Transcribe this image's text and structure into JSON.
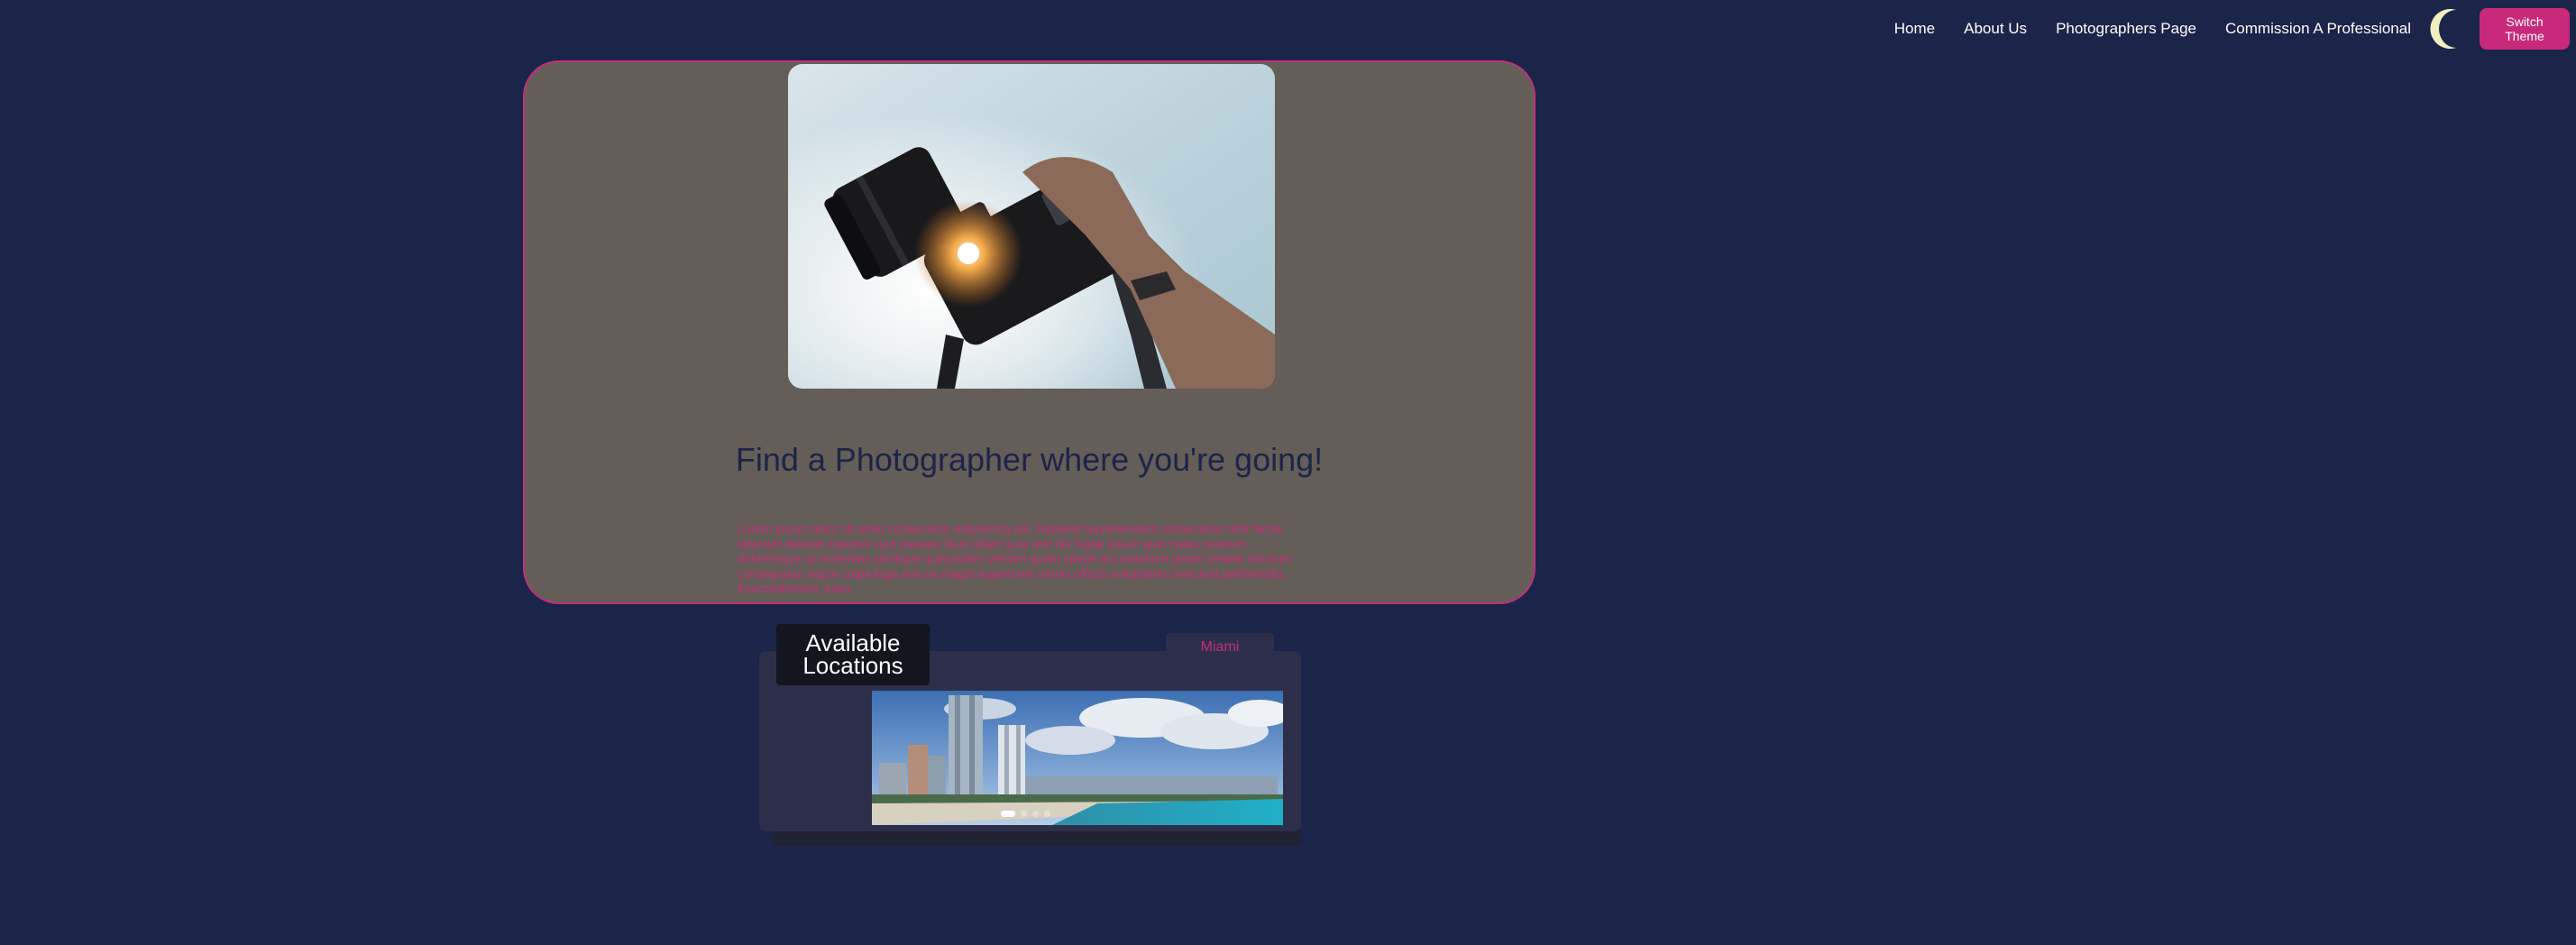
{
  "nav": {
    "links": [
      "Home",
      "About Us",
      "Photographers Page",
      "Commission A Professional"
    ],
    "theme_icon": "moon-icon",
    "switch_theme_label": "Switch Theme"
  },
  "hero": {
    "image": "hand-holding-camera-photo",
    "title": "Find a Photographer where you're going!",
    "body": "Lorem ipsum dolor sit amet consectetur adipisicing elit. Repellat reprehenderit consectetur nihil facilis laborum deleniti maiores sunt pariatur illum ullam quia rem illo fugiat ipsum quis natus nostrum doloremque ut molestias similique quibusdam veniam quam saepe accusantium ipsam beatae dolorum consequatur atque culpa fuga eos ea magni asperiores omnis officiis voluptatem nesciunt perferendis. Exercitationem, iusto."
  },
  "locations": {
    "heading": "Available Locations",
    "active_tab": "Miami",
    "image": "miami-beach-skyline-photo",
    "slide_count": 4,
    "active_slide": 1
  },
  "colors": {
    "background": "#1b2449",
    "accent": "#c8297a",
    "hero_bg": "#655d58",
    "panel_bg": "#2d2f4a",
    "moon": "#f3eec2"
  }
}
